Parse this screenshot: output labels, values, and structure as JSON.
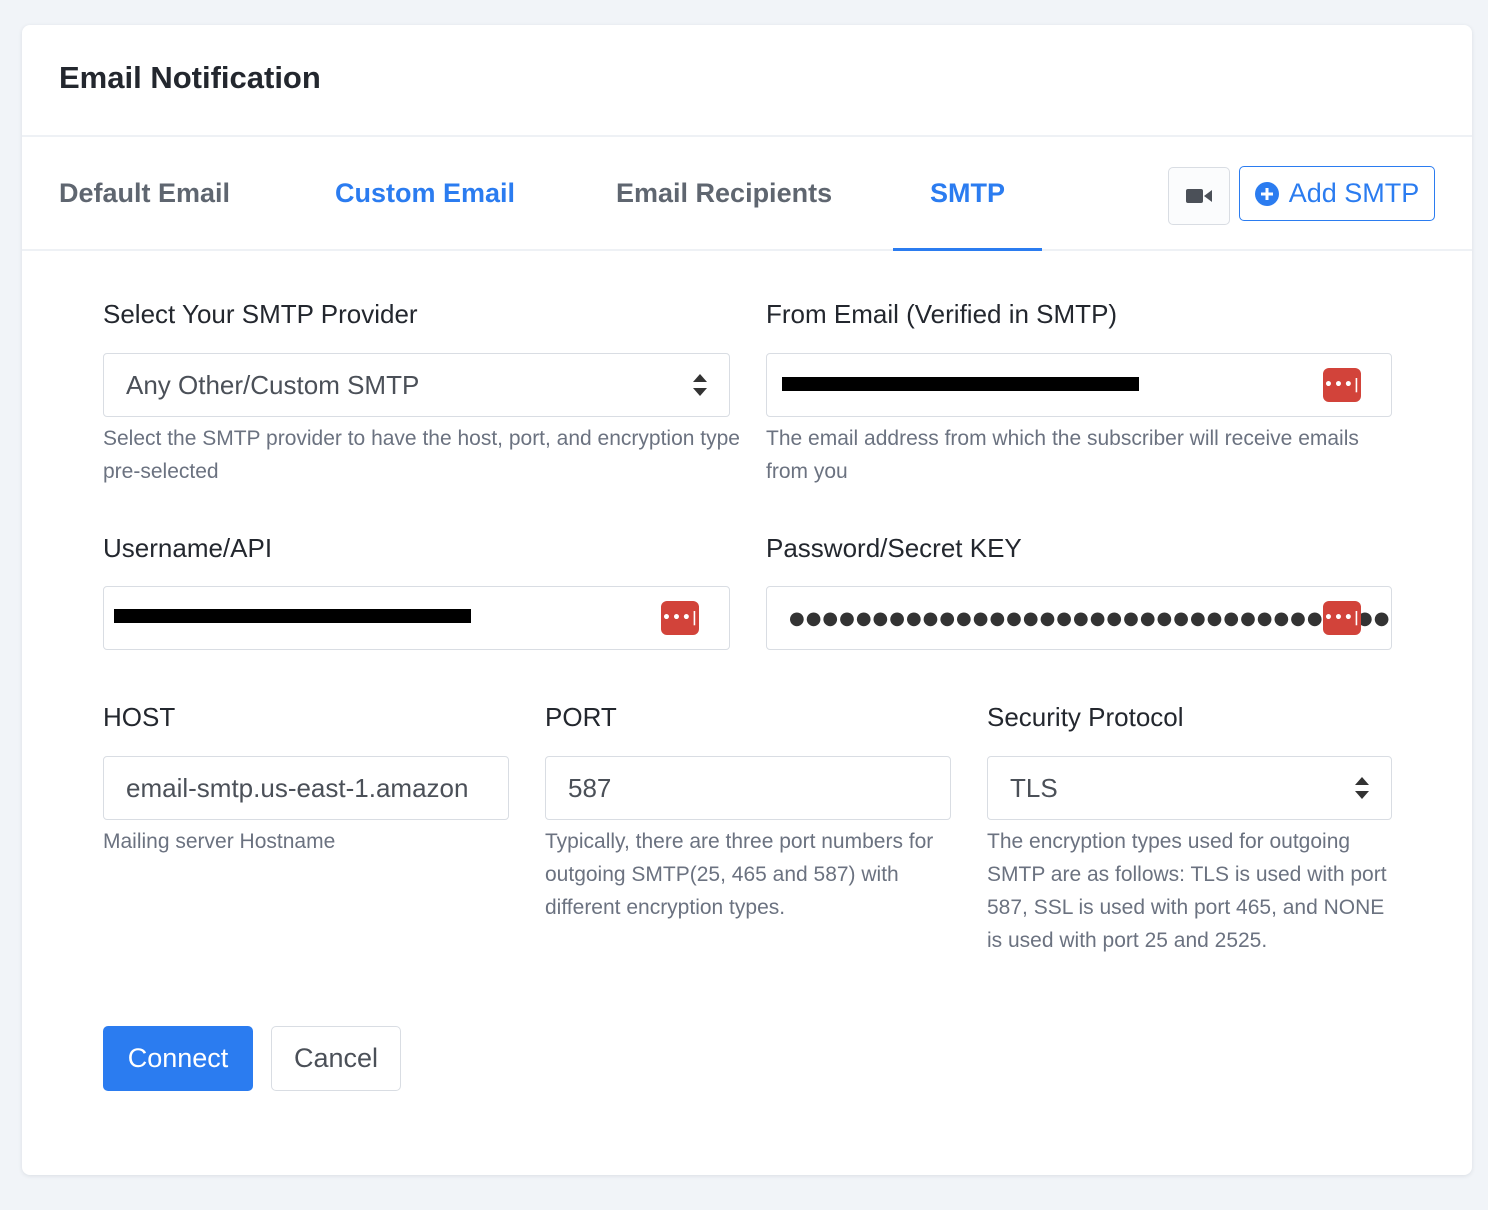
{
  "header": {
    "title": "Email Notification"
  },
  "tabs": [
    {
      "label": "Default Email",
      "state": "default"
    },
    {
      "label": "Custom Email",
      "state": "link"
    },
    {
      "label": "Email Recipients",
      "state": "default"
    },
    {
      "label": "SMTP",
      "state": "active"
    }
  ],
  "toolbar": {
    "video_icon": "video-camera-icon",
    "add_smtp_label": "Add SMTP",
    "add_smtp_icon": "plus-circle-icon"
  },
  "form": {
    "provider": {
      "label": "Select Your SMTP Provider",
      "value": "Any Other/Custom SMTP",
      "help": "Select the SMTP provider to have the host, port, and encryption type pre-selected"
    },
    "from_email": {
      "label": "From Email (Verified in SMTP)",
      "value": "",
      "redacted": true,
      "help": "The email address from which the subscriber will receive emails from you"
    },
    "username": {
      "label": "Username/API",
      "value": "",
      "redacted": true
    },
    "password": {
      "label": "Password/Secret KEY",
      "value": "●●●●●●●●●●●●●●●●●●●●●●●●●●●●●●●●●●●●●●●●"
    },
    "host": {
      "label": "HOST",
      "value": "email-smtp.us-east-1.amazon",
      "help": "Mailing server Hostname"
    },
    "port": {
      "label": "PORT",
      "value": "587",
      "help": "Typically, there are three port numbers for outgoing SMTP(25, 465 and 587) with different encryption types."
    },
    "security": {
      "label": "Security Protocol",
      "value": "TLS",
      "help": "The encryption types used for outgoing SMTP are as follows: TLS is used with port 587, SSL is used with port 465, and NONE is used with port 25 and 2525."
    },
    "password_manager_icon": "password-manager-icon",
    "password_manager_glyph": "•••|"
  },
  "actions": {
    "connect_label": "Connect",
    "cancel_label": "Cancel"
  },
  "colors": {
    "accent": "#2b7cf0",
    "password_manager": "#d2433a"
  }
}
